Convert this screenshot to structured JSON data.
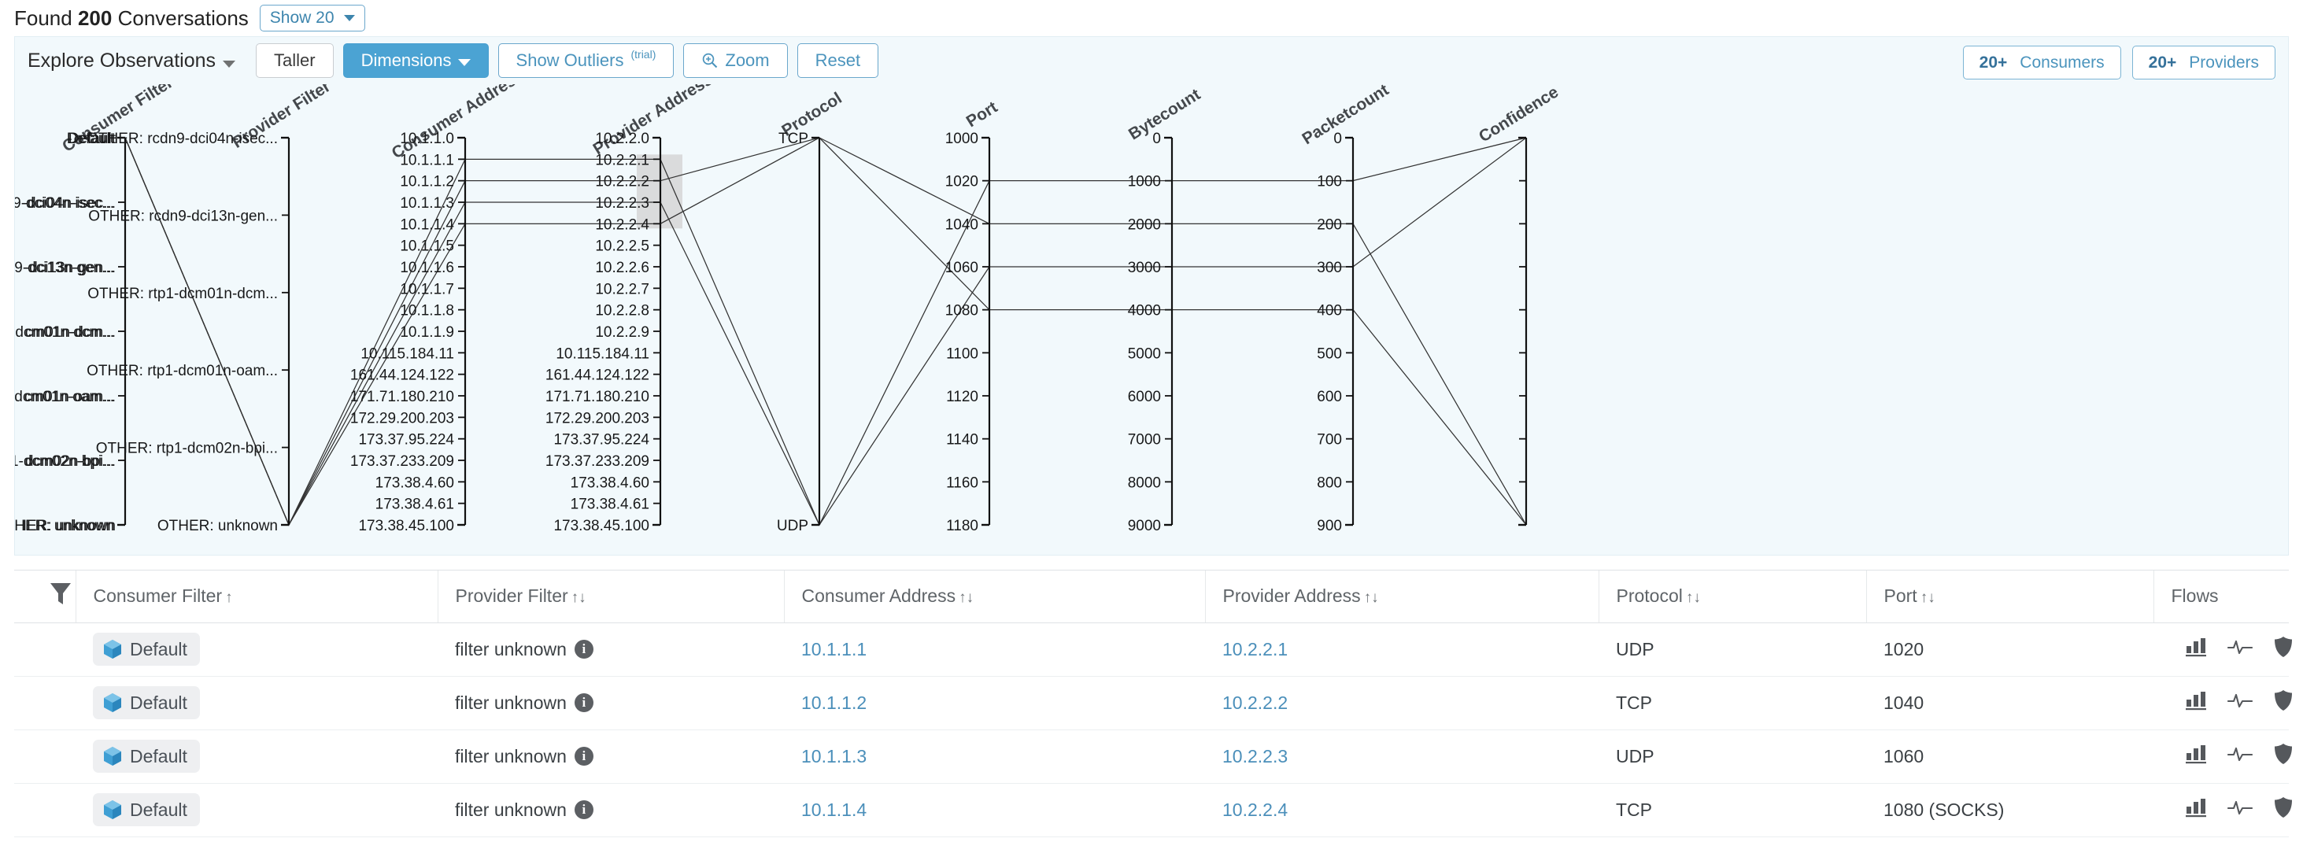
{
  "found_bar": {
    "prefix": "Found",
    "count": "200",
    "suffix": "Conversations",
    "show_select_label": "Show 20"
  },
  "explore": {
    "title": "Explore Observations",
    "buttons": [
      {
        "label": "Taller",
        "style": "plain"
      },
      {
        "label": "Dimensions",
        "style": "filled-blue"
      },
      {
        "label": "Show Outliers",
        "sup": "(trial)",
        "style": "outline-blue"
      },
      {
        "label": "Zoom",
        "style": "outline-blue",
        "icon": "zoom-in-icon"
      },
      {
        "label": "Reset",
        "style": "outline-blue"
      }
    ],
    "pills": [
      {
        "count": "20+",
        "label": "Consumers"
      },
      {
        "count": "20+",
        "label": "Providers"
      }
    ]
  },
  "chart_data": {
    "type": "parallel-coordinates",
    "title": "Explore Observations",
    "background": "#f2f9fc",
    "brush": {
      "axis": "Provider Address",
      "from": "10.2.2.1",
      "to": "10.2.2.4"
    },
    "axes": [
      {
        "name": "Consumer Filter",
        "kind": "categorical",
        "left_labels": [
          "Default",
          "-dci04n-isec...",
          "-dci13n-gen...",
          "cm01n-dcm...",
          "cm01n-oam...",
          "dcm02n-bpi...",
          "IER: unknown"
        ],
        "ticks": [
          "Default",
          "OTHER: rcdn9-dci04n-isec...",
          "OTHER: rcdn9-dci13n-gen...",
          "OTHER: rtp1-dcm01n-dcm...",
          "OTHER: rtp1-dcm01n-oam...",
          "OTHER: rtp1-dcm02n-bpi...",
          "OTHER: unknown"
        ]
      },
      {
        "name": "Provider Filter",
        "kind": "categorical",
        "ticks": [
          "OTHER: rcdn9-dci04n-isec...",
          "OTHER: rcdn9-dci13n-gen...",
          "OTHER: rtp1-dcm01n-dcm...",
          "OTHER: rtp1-dcm01n-oam...",
          "OTHER: rtp1-dcm02n-bpi...",
          "OTHER: unknown"
        ]
      },
      {
        "name": "Consumer Address",
        "kind": "categorical",
        "ticks": [
          "10.1.1.0",
          "10.1.1.1",
          "10.1.1.2",
          "10.1.1.3",
          "10.1.1.4",
          "10.1.1.5",
          "10.1.1.6",
          "10.1.1.7",
          "10.1.1.8",
          "10.1.1.9",
          "10.115.184.11",
          "161.44.124.122",
          "171.71.180.210",
          "172.29.200.203",
          "173.37.95.224",
          "173.37.233.209",
          "173.38.4.60",
          "173.38.4.61",
          "173.38.45.100"
        ]
      },
      {
        "name": "Provider Address",
        "kind": "categorical",
        "ticks": [
          "10.2.2.0",
          "10.2.2.1",
          "10.2.2.2",
          "10.2.2.3",
          "10.2.2.4",
          "10.2.2.5",
          "10.2.2.6",
          "10.2.2.7",
          "10.2.2.8",
          "10.2.2.9",
          "10.115.184.11",
          "161.44.124.122",
          "171.71.180.210",
          "172.29.200.203",
          "173.37.95.224",
          "173.37.233.209",
          "173.38.4.60",
          "173.38.4.61",
          "173.38.45.100"
        ]
      },
      {
        "name": "Protocol",
        "kind": "categorical",
        "ticks": [
          "TCP",
          "UDP"
        ]
      },
      {
        "name": "Port",
        "kind": "numeric",
        "ticks": [
          "1000",
          "1020",
          "1040",
          "1060",
          "1080",
          "1100",
          "1120",
          "1140",
          "1160",
          "1180"
        ]
      },
      {
        "name": "Bytecount",
        "kind": "numeric",
        "ticks": [
          "0",
          "1000",
          "2000",
          "3000",
          "4000",
          "5000",
          "6000",
          "7000",
          "8000",
          "9000"
        ]
      },
      {
        "name": "Packetcount",
        "kind": "numeric",
        "ticks": [
          "0",
          "100",
          "200",
          "300",
          "400",
          "500",
          "600",
          "700",
          "800",
          "900"
        ]
      },
      {
        "name": "Confidence",
        "kind": "numeric",
        "ticks": [
          "",
          "",
          "",
          "",
          "",
          "",
          "",
          "",
          "",
          ""
        ]
      }
    ],
    "series": [
      {
        "consumer_address": "10.1.1.1",
        "provider_address": "10.2.2.1",
        "protocol": "UDP",
        "port": 1020,
        "bytecount": 1000,
        "packetcount": 100
      },
      {
        "consumer_address": "10.1.1.2",
        "provider_address": "10.2.2.2",
        "protocol": "TCP",
        "port": 1040,
        "bytecount": 2000,
        "packetcount": 200
      },
      {
        "consumer_address": "10.1.1.3",
        "provider_address": "10.2.2.3",
        "protocol": "UDP",
        "port": 1060,
        "bytecount": 3000,
        "packetcount": 300
      },
      {
        "consumer_address": "10.1.1.4",
        "provider_address": "10.2.2.4",
        "protocol": "TCP",
        "port": 1080,
        "bytecount": 4000,
        "packetcount": 400
      }
    ]
  },
  "table": {
    "columns": [
      {
        "label": "Consumer Filter",
        "sort": "↑"
      },
      {
        "label": "Provider Filter",
        "sort": "↑↓"
      },
      {
        "label": "Consumer Address",
        "sort": "↑↓"
      },
      {
        "label": "Provider Address",
        "sort": "↑↓"
      },
      {
        "label": "Protocol",
        "sort": "↑↓"
      },
      {
        "label": "Port",
        "sort": "↑↓"
      },
      {
        "label": "Flows",
        "sort": ""
      }
    ],
    "rows": [
      {
        "consumer_filter": "Default",
        "provider_filter": "filter unknown",
        "consumer_address": "10.1.1.1",
        "provider_address": "10.2.2.1",
        "protocol": "UDP",
        "port": "1020"
      },
      {
        "consumer_filter": "Default",
        "provider_filter": "filter unknown",
        "consumer_address": "10.1.1.2",
        "provider_address": "10.2.2.2",
        "protocol": "TCP",
        "port": "1040"
      },
      {
        "consumer_filter": "Default",
        "provider_filter": "filter unknown",
        "consumer_address": "10.1.1.3",
        "provider_address": "10.2.2.3",
        "protocol": "UDP",
        "port": "1060"
      },
      {
        "consumer_filter": "Default",
        "provider_filter": "filter unknown",
        "consumer_address": "10.1.1.4",
        "provider_address": "10.2.2.4",
        "protocol": "TCP",
        "port": "1080 (SOCKS)"
      }
    ]
  },
  "colors": {
    "accent": "#4ba3d3",
    "link": "#4b8fba",
    "panel_bg": "#f2f9fc",
    "brush": "#d4d4d4"
  }
}
